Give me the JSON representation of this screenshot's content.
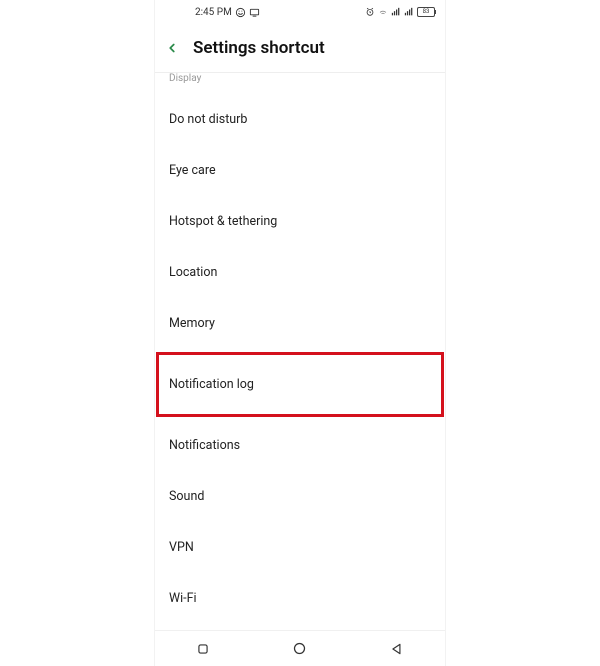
{
  "status": {
    "time": "2:45 PM",
    "battery_level": "83"
  },
  "header": {
    "title": "Settings shortcut"
  },
  "items": [
    {
      "label": "Display",
      "cutoff": true
    },
    {
      "label": "Do not disturb"
    },
    {
      "label": "Eye care"
    },
    {
      "label": "Hotspot & tethering"
    },
    {
      "label": "Location"
    },
    {
      "label": "Memory"
    },
    {
      "label": "Notification log",
      "highlighted": true
    },
    {
      "label": "Notifications"
    },
    {
      "label": "Sound"
    },
    {
      "label": "VPN"
    },
    {
      "label": "Wi-Fi"
    }
  ]
}
